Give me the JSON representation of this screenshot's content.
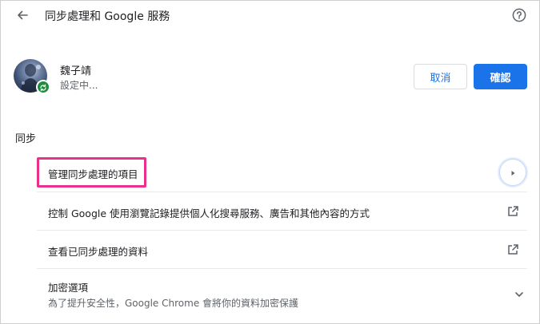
{
  "header": {
    "title": "同步處理和 Google 服務",
    "back_icon": "arrow-back-icon",
    "help_icon": "help-icon"
  },
  "profile": {
    "name": "魏子靖",
    "status": "設定中...",
    "cancel_label": "取消",
    "confirm_label": "確認"
  },
  "sync": {
    "section_title": "同步",
    "rows": [
      {
        "label": "管理同步處理的項目",
        "icon": "arrow-right-icon"
      },
      {
        "label": "控制 Google 使用瀏覽記錄提供個人化搜尋服務、廣告和其他內容的方式",
        "icon": "open-in-new-icon"
      },
      {
        "label": "查看已同步處理的資料",
        "icon": "open-in-new-icon"
      },
      {
        "label": "加密選項",
        "sublabel": "為了提升安全性，Google Chrome 會將你的資料加密保護",
        "icon": "chevron-down-icon"
      }
    ]
  },
  "colors": {
    "accent": "#1a73e8",
    "highlight": "#e8308c",
    "sync_badge": "#1e8e3e"
  }
}
